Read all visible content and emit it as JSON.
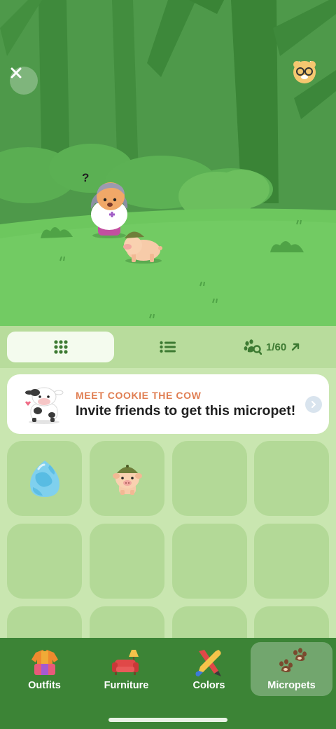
{
  "scene": {
    "close_icon": "close-icon",
    "lab": {
      "label": "Lab",
      "icon": "lab-avatar-icon"
    },
    "character_thought": "?"
  },
  "tabs": {
    "grid_icon": "grid-view-icon",
    "list_icon": "list-view-icon",
    "collection_icon": "paw-search-icon",
    "collection_count": "1/60",
    "collection_arrow_icon": "arrow-up-right-icon",
    "active": "grid"
  },
  "banner": {
    "eyebrow": "MEET COOKIE THE COW",
    "headline": "Invite friends to get this micropet!",
    "icon": "cow-icon",
    "chevron_icon": "chevron-right-icon"
  },
  "micropets": {
    "items": [
      {
        "name": "egg",
        "icon": "egg-icon"
      },
      {
        "name": "pig-with-helmet",
        "icon": "pig-icon"
      },
      {
        "name": "",
        "icon": ""
      },
      {
        "name": "",
        "icon": ""
      },
      {
        "name": "",
        "icon": ""
      },
      {
        "name": "",
        "icon": ""
      },
      {
        "name": "",
        "icon": ""
      },
      {
        "name": "",
        "icon": ""
      },
      {
        "name": "",
        "icon": ""
      },
      {
        "name": "",
        "icon": ""
      },
      {
        "name": "",
        "icon": ""
      },
      {
        "name": "",
        "icon": ""
      }
    ]
  },
  "bottom_nav": {
    "items": [
      {
        "label": "Outfits",
        "icon": "outfits-icon"
      },
      {
        "label": "Furniture",
        "icon": "furniture-icon"
      },
      {
        "label": "Colors",
        "icon": "colors-icon"
      },
      {
        "label": "Micropets",
        "icon": "micropets-icon"
      }
    ],
    "active": "Micropets"
  },
  "colors": {
    "accent_text": "#e07e52",
    "tab_text": "#3d7a32",
    "nav_bg": "#3c8436",
    "cell_bg": "#b3d997"
  }
}
